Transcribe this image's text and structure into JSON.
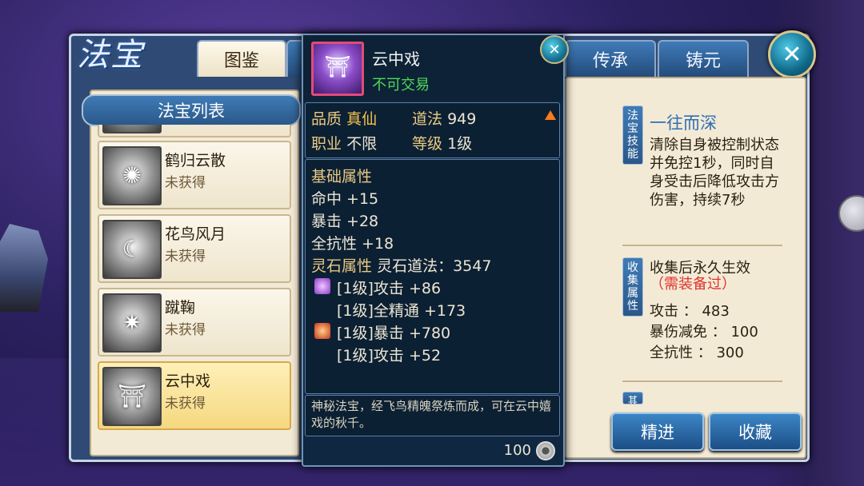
{
  "header": {
    "logo_text": "法宝",
    "tabs": [
      {
        "label": "图鉴",
        "active": true
      },
      {
        "label": "传承",
        "active": false
      },
      {
        "label": "铸元",
        "active": false
      }
    ]
  },
  "treasure_list": {
    "title": "法宝列表",
    "items": [
      {
        "name": "鹤归云散",
        "status": "未获得",
        "selected": false,
        "icon": "crane-cloud-icon"
      },
      {
        "name": "花鸟风月",
        "status": "未获得",
        "selected": false,
        "icon": "crescent-moon-icon"
      },
      {
        "name": "蹴鞠",
        "status": "未获得",
        "selected": false,
        "icon": "ball-icon"
      },
      {
        "name": "云中戏",
        "status": "未获得",
        "selected": true,
        "icon": "swing-icon"
      }
    ]
  },
  "tooltip": {
    "item_name": "云中戏",
    "trade_status": "不可交易",
    "quality_label": "品质",
    "quality_value": "真仙",
    "power_label": "道法",
    "power_value": "949",
    "class_label": "职业",
    "class_value": "不限",
    "level_label": "等级",
    "level_value": "1级",
    "base_title": "基础属性",
    "base_stats": [
      "命中 +15",
      "暴击 +28",
      "全抗性 +18"
    ],
    "stone_title": "灵石属性",
    "stone_power": "灵石道法：3547",
    "stone_stats": [
      "[1级]攻击 +86",
      "[1级]全精通 +173",
      "[1级]暴击 +780",
      "[1级]攻击 +52"
    ],
    "description": "神秘法宝，经飞鸟精魄祭炼而成，可在云中嬉戏的秋千。",
    "price": "100",
    "colors": {
      "trade": "#4fd858",
      "quality": "#f4c24b",
      "label": "#e9c981"
    }
  },
  "detail": {
    "skill_tag": "法宝技能",
    "skill_name": "一往而深",
    "skill_desc": "清除自身被控制状态并免控1秒，同时自身受击后降低攻击方伤害，持续7秒",
    "collect_tag": "收集属性",
    "collect_title": "收集后永久生效",
    "collect_note": "（需装备过）",
    "collect_stats": [
      "攻击 ： 483",
      "暴伤减免 ： 100",
      "全抗性 ： 300"
    ],
    "next_tag": "其",
    "buttons": {
      "refine": "精进",
      "favorite": "收藏"
    }
  }
}
